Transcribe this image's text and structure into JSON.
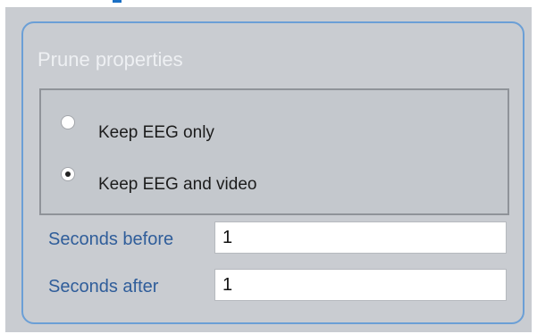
{
  "group": {
    "title": "Prune properties"
  },
  "options": [
    {
      "label": "Keep EEG only",
      "checked": false
    },
    {
      "label": "Keep EEG and video",
      "checked": true
    }
  ],
  "fields": {
    "seconds_before": {
      "label": "Seconds before",
      "value": "1"
    },
    "seconds_after": {
      "label": "Seconds after",
      "value": "1"
    }
  },
  "colors": {
    "accent": "#6b9fd6",
    "label_blue": "#2f5d9a",
    "dialog_bg": "#c9ccd1"
  }
}
